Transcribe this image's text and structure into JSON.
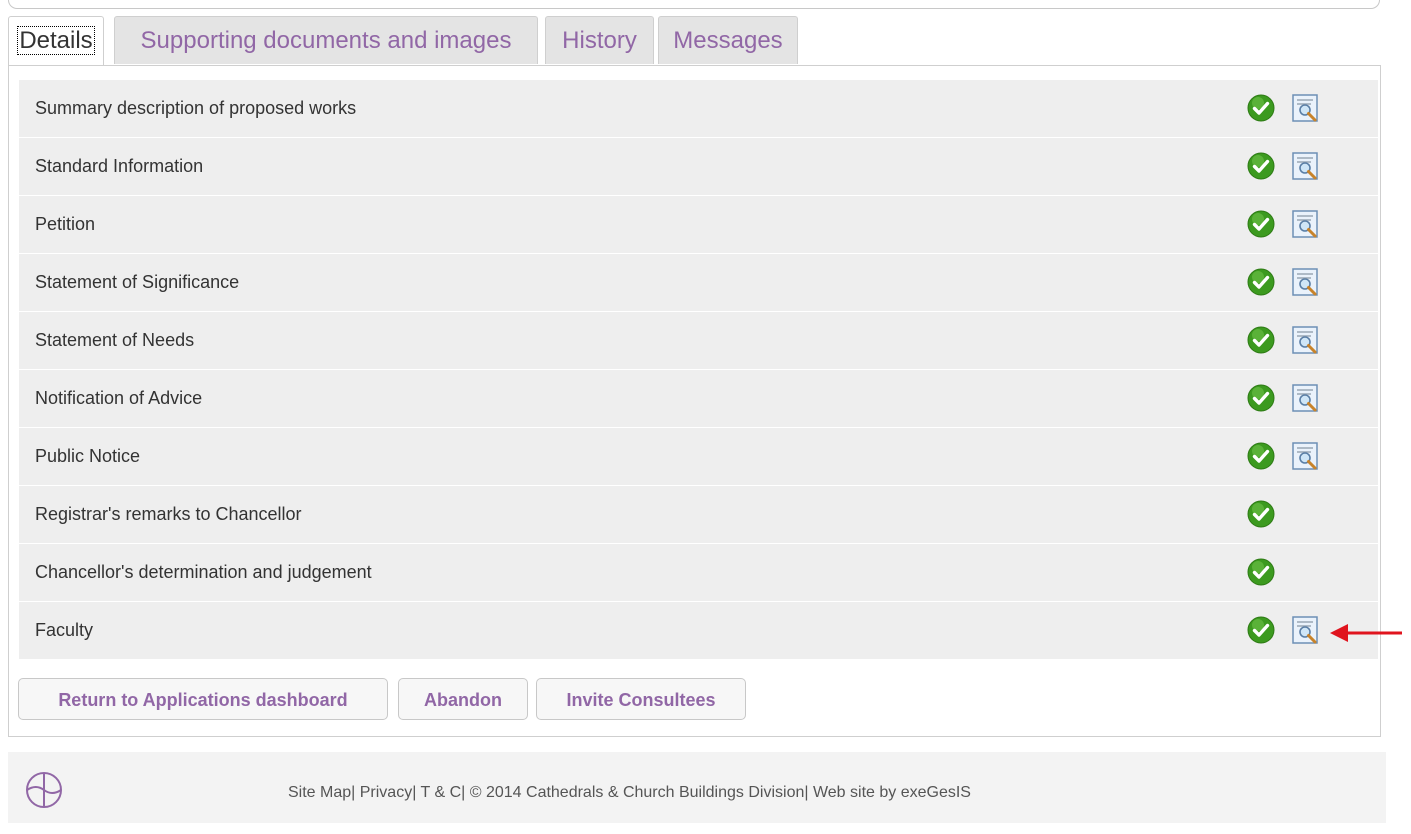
{
  "tabs": [
    {
      "label": "Details",
      "active": true
    },
    {
      "label": "Supporting documents and images",
      "active": false
    },
    {
      "label": "History",
      "active": false
    },
    {
      "label": "Messages",
      "active": false
    }
  ],
  "sections": [
    {
      "label": "Summary description of proposed works",
      "status_icon": "check-icon",
      "has_view": true
    },
    {
      "label": "Standard Information",
      "status_icon": "check-icon",
      "has_view": true
    },
    {
      "label": "Petition",
      "status_icon": "check-icon",
      "has_view": true
    },
    {
      "label": "Statement of Significance",
      "status_icon": "check-icon",
      "has_view": true
    },
    {
      "label": "Statement of Needs",
      "status_icon": "check-icon",
      "has_view": true
    },
    {
      "label": "Notification of Advice",
      "status_icon": "check-icon",
      "has_view": true
    },
    {
      "label": "Public Notice",
      "status_icon": "check-icon",
      "has_view": true
    },
    {
      "label": "Registrar's remarks to Chancellor",
      "status_icon": "check-icon",
      "has_view": false
    },
    {
      "label": "Chancellor's determination and judgement",
      "status_icon": "check-icon",
      "has_view": false
    },
    {
      "label": "Faculty",
      "status_icon": "check-icon",
      "has_view": true
    }
  ],
  "buttons": {
    "return_label": "Return to Applications dashboard",
    "abandon_label": "Abandon",
    "invite_label": "Invite Consultees"
  },
  "footer": {
    "site_map": "Site Map",
    "privacy": "Privacy",
    "terms": "T & C",
    "copyright": "© 2014 Cathedrals & Church Buildings Division",
    "credit": "Web site by exeGesIS",
    "separator": "|"
  },
  "colors": {
    "accent_purple": "#9167a6",
    "check_green": "#3c9a1f",
    "annotation_red": "#e0141e",
    "row_bg": "#eeeeee"
  }
}
